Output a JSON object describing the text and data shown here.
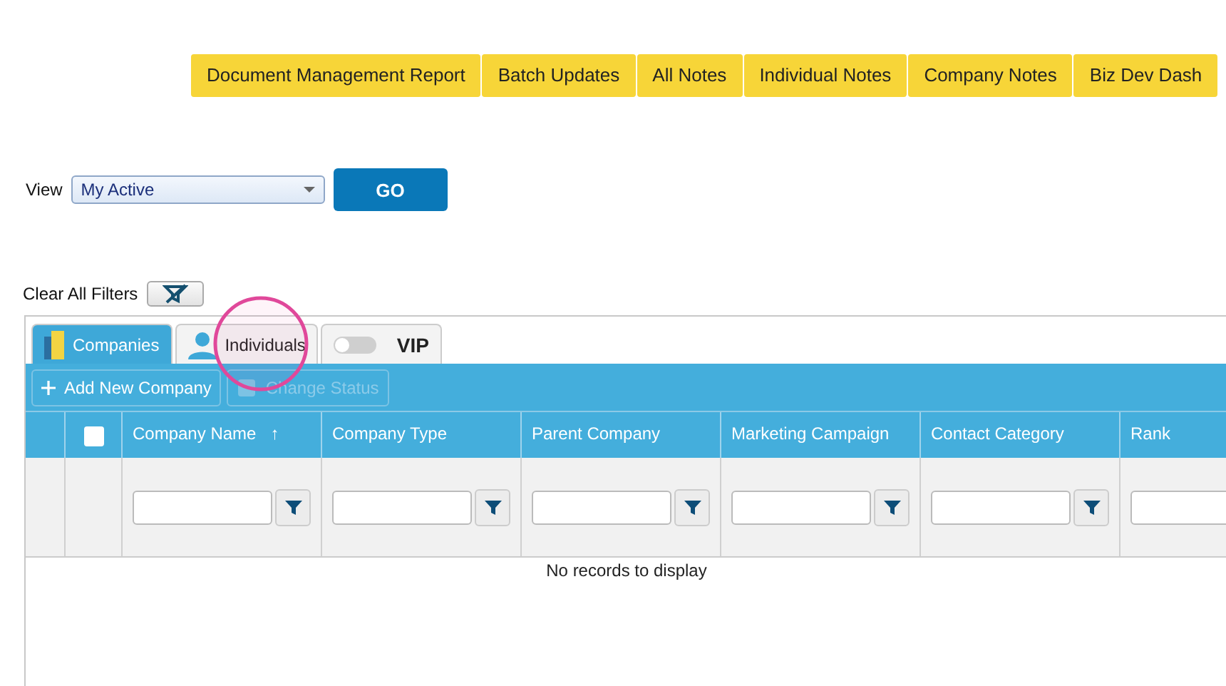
{
  "nav_tabs": [
    {
      "label": "Document Management Report"
    },
    {
      "label": "Batch Updates"
    },
    {
      "label": "All Notes"
    },
    {
      "label": "Individual Notes"
    },
    {
      "label": "Company Notes"
    },
    {
      "label": "Biz Dev Dash"
    }
  ],
  "view": {
    "label": "View",
    "value": "My Active",
    "button": "GO"
  },
  "clear_filters": {
    "label": "Clear All Filters"
  },
  "grid_tabs": [
    {
      "kind": "companies",
      "label": "Companies",
      "selected": true
    },
    {
      "kind": "individuals",
      "label": "Individuals",
      "selected": false,
      "highlighted": true
    },
    {
      "kind": "vip",
      "label": "VIP",
      "selected": false,
      "on": false
    }
  ],
  "toolbar": [
    {
      "label": "Add New Company",
      "disabled": false,
      "kind": "add"
    },
    {
      "label": "Change Status",
      "disabled": true,
      "kind": "status"
    }
  ],
  "table": {
    "select_all": {
      "checked": false
    },
    "columns": [
      {
        "label": "Company Name",
        "sort_mark": "↑"
      },
      {
        "label": "Company Type"
      },
      {
        "label": "Parent Company"
      },
      {
        "label": "Marketing Campaign"
      },
      {
        "label": "Contact Category"
      },
      {
        "label": "Rank"
      }
    ],
    "empty_message": "No records to display"
  }
}
